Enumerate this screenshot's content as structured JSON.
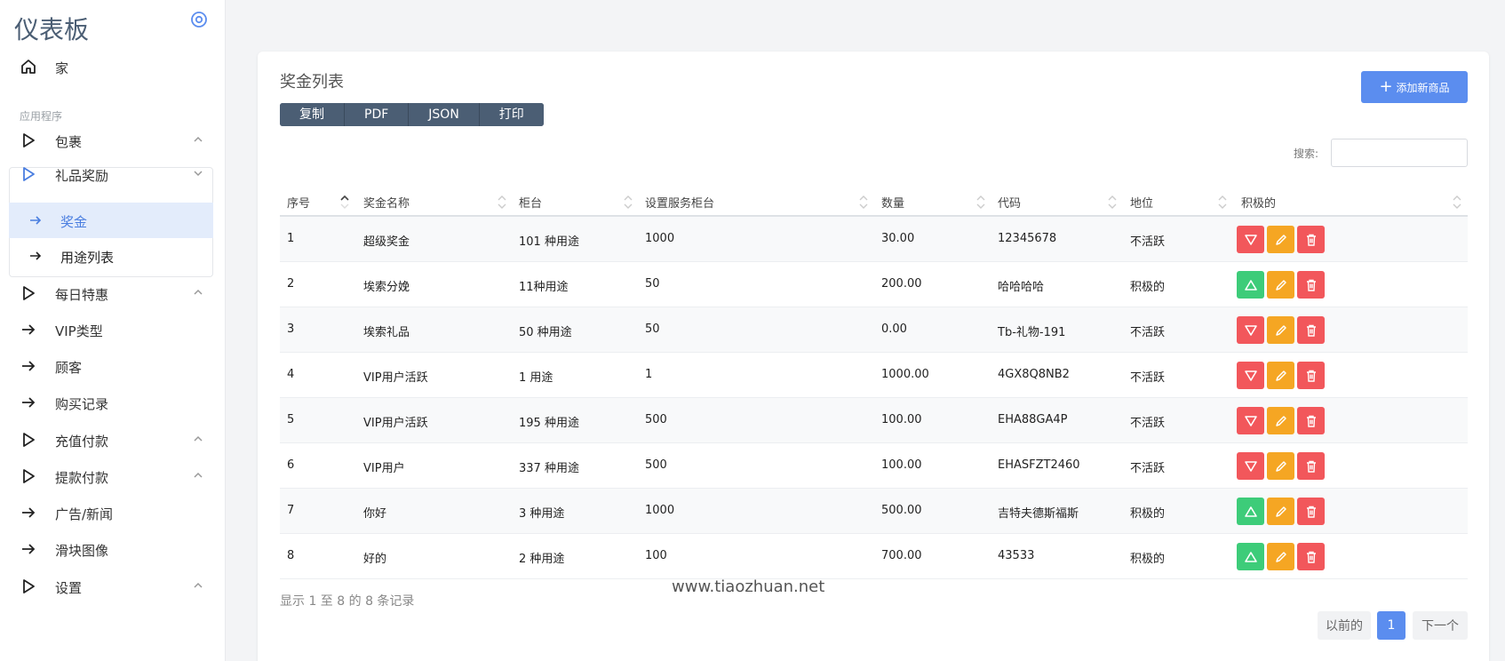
{
  "sidebar": {
    "brand": "仪表板",
    "home": "家",
    "section": "应用程序",
    "items": [
      {
        "label": "包裹"
      },
      {
        "label": "礼品奖励"
      },
      {
        "label": "每日特惠"
      },
      {
        "label": "VIP类型"
      },
      {
        "label": "顾客"
      },
      {
        "label": "购买记录"
      },
      {
        "label": "充值付款"
      },
      {
        "label": "提款付款"
      },
      {
        "label": "广告/新闻"
      },
      {
        "label": "滑块图像"
      },
      {
        "label": "设置"
      }
    ],
    "sub": [
      {
        "label": "奖金"
      },
      {
        "label": "用途列表"
      }
    ]
  },
  "card": {
    "title": "奖金列表",
    "export": [
      "复制",
      "PDF",
      "JSON",
      "打印"
    ],
    "add_label": "添加新商品",
    "search_label": "搜索:",
    "search_value": ""
  },
  "table": {
    "headers": [
      "序号",
      "奖金名称",
      "柜台",
      "设置服务柜台",
      "数量",
      "代码",
      "地位",
      "积极的"
    ],
    "rows": [
      {
        "no": "1",
        "name": "超级奖金",
        "counter": "101 种用途",
        "service": "1000",
        "qty": "30.00",
        "code": "12345678",
        "status": "不活跃",
        "active": false
      },
      {
        "no": "2",
        "name": "埃索分娩",
        "counter": "11种用途",
        "service": "50",
        "qty": "200.00",
        "code": "哈哈哈哈",
        "status": "积极的",
        "active": true
      },
      {
        "no": "3",
        "name": "埃索礼品",
        "counter": "50 种用途",
        "service": "50",
        "qty": "0.00",
        "code": "Tb-礼物-191",
        "status": "不活跃",
        "active": false
      },
      {
        "no": "4",
        "name": "VIP用户活跃",
        "counter": "1 用途",
        "service": "1",
        "qty": "1000.00",
        "code": "4GX8Q8NB2",
        "status": "不活跃",
        "active": false
      },
      {
        "no": "5",
        "name": "VIP用户活跃",
        "counter": "195 种用途",
        "service": "500",
        "qty": "100.00",
        "code": "EHA88GA4P",
        "status": "不活跃",
        "active": false
      },
      {
        "no": "6",
        "name": "VIP用户",
        "counter": "337 种用途",
        "service": "500",
        "qty": "100.00",
        "code": "EHASFZT2460",
        "status": "不活跃",
        "active": false
      },
      {
        "no": "7",
        "name": "你好",
        "counter": "3 种用途",
        "service": "1000",
        "qty": "500.00",
        "code": "吉特夫德斯福斯",
        "status": "积极的",
        "active": true
      },
      {
        "no": "8",
        "name": "好的",
        "counter": "2 种用途",
        "service": "100",
        "qty": "700.00",
        "code": "43533",
        "status": "积极的",
        "active": true
      }
    ]
  },
  "footer": {
    "summary": "显示 1 至 8 的 8 条记录",
    "watermark": "www.tiaozhuan.net",
    "prev": "以前的",
    "page": "1",
    "next": "下一个"
  },
  "colors": {
    "accent": "#5b8def",
    "danger": "#f2575b",
    "success": "#3dcc79",
    "warning": "#f5a623",
    "dark": "#4b5e74"
  }
}
